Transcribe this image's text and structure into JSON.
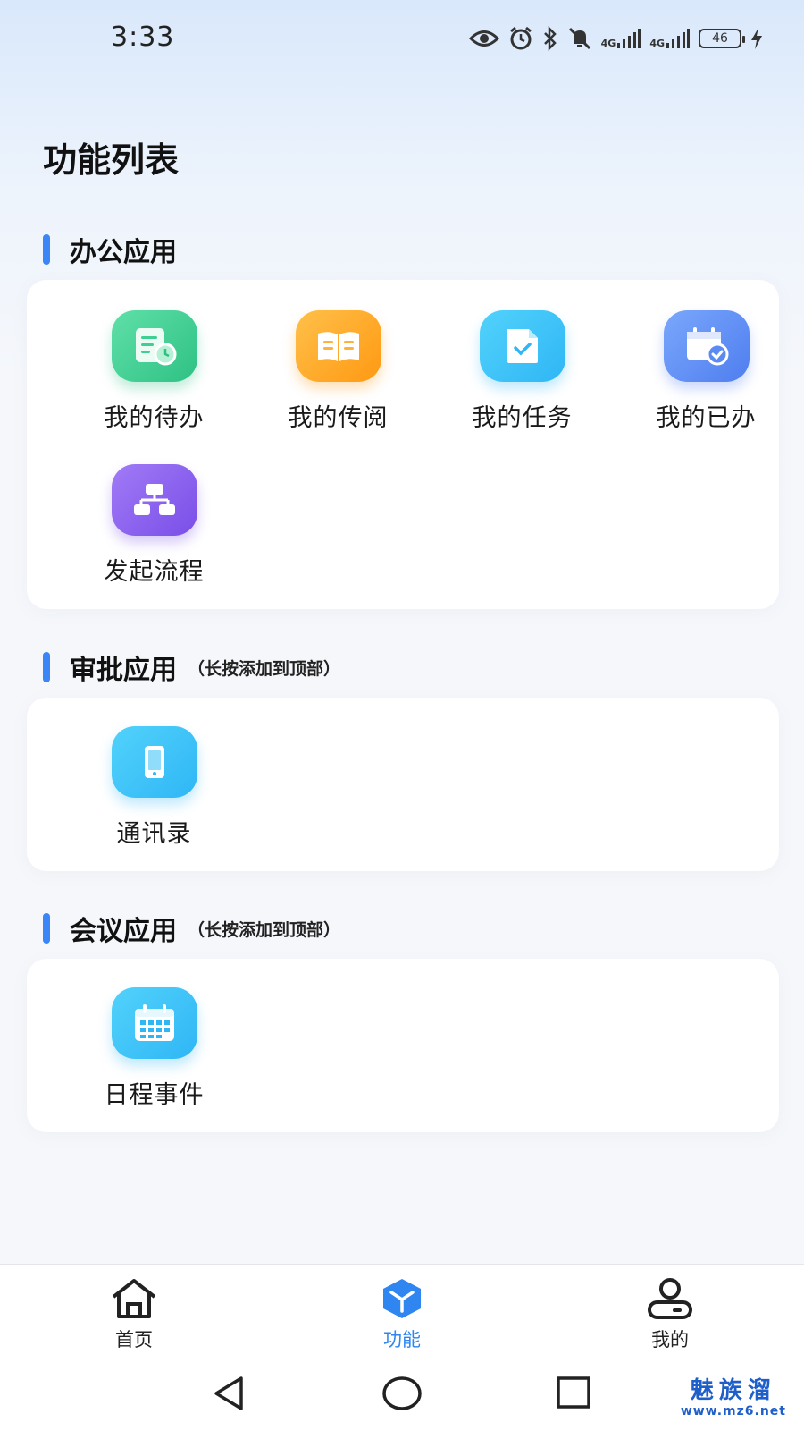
{
  "status": {
    "time": "3:33",
    "net1": "4G",
    "net2": "4G",
    "battery": "46"
  },
  "page": {
    "title": "功能列表"
  },
  "sections": [
    {
      "title": "办公应用",
      "hint": "",
      "items": [
        {
          "label": "我的待办",
          "icon": "todo-icon",
          "color": "#3ecf93"
        },
        {
          "label": "我的传阅",
          "icon": "book-icon",
          "color": "#ffa51e"
        },
        {
          "label": "我的任务",
          "icon": "task-doc-icon",
          "color": "#3cc3f8"
        },
        {
          "label": "我的已办",
          "icon": "calendar-done-icon",
          "color": "#5b8bf2"
        },
        {
          "label": "发起流程",
          "icon": "flowchart-icon",
          "color": "#8a5cf0"
        }
      ]
    },
    {
      "title": "审批应用",
      "hint": "（长按添加到顶部）",
      "items": [
        {
          "label": "通讯录",
          "icon": "phone-icon",
          "color": "#34bff7"
        }
      ]
    },
    {
      "title": "会议应用",
      "hint": "（长按添加到顶部）",
      "items": [
        {
          "label": "日程事件",
          "icon": "calendar-grid-icon",
          "color": "#34bff7"
        }
      ]
    }
  ],
  "tabbar": {
    "tabs": [
      {
        "label": "首页",
        "icon": "home-icon",
        "active": false
      },
      {
        "label": "功能",
        "icon": "cube-icon",
        "active": true
      },
      {
        "label": "我的",
        "icon": "user-icon",
        "active": false
      }
    ],
    "accent": "#2f86f0"
  },
  "watermark": {
    "name": "魅族溜",
    "url": "www.mz6.net"
  }
}
